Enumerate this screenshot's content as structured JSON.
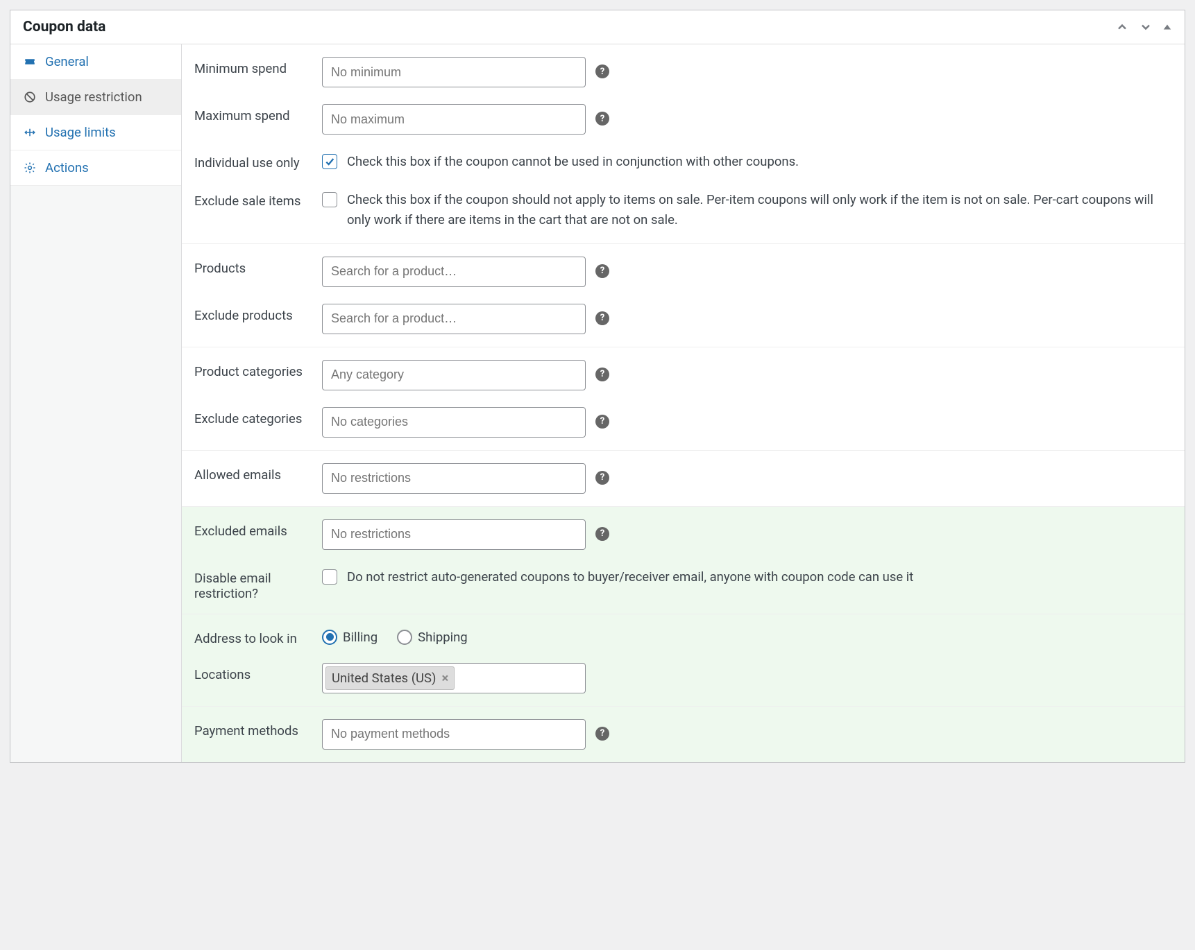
{
  "panel": {
    "title": "Coupon data"
  },
  "tabs": {
    "general": "General",
    "usage_restriction": "Usage restriction",
    "usage_limits": "Usage limits",
    "actions": "Actions"
  },
  "labels": {
    "minimum_spend": "Minimum spend",
    "maximum_spend": "Maximum spend",
    "individual_use": "Individual use only",
    "exclude_sale": "Exclude sale items",
    "products": "Products",
    "exclude_products": "Exclude products",
    "product_categories": "Product categories",
    "exclude_categories": "Exclude categories",
    "allowed_emails": "Allowed emails",
    "excluded_emails": "Excluded emails",
    "disable_email_restriction": "Disable email restriction?",
    "address_to_look_in": "Address to look in",
    "locations": "Locations",
    "payment_methods": "Payment methods"
  },
  "placeholders": {
    "minimum_spend": "No minimum",
    "maximum_spend": "No maximum",
    "search_product": "Search for a product…",
    "any_category": "Any category",
    "no_categories": "No categories",
    "no_restrictions": "No restrictions",
    "no_payment_methods": "No payment methods"
  },
  "descriptions": {
    "individual_use": "Check this box if the coupon cannot be used in conjunction with other coupons.",
    "exclude_sale": "Check this box if the coupon should not apply to items on sale. Per-item coupons will only work if the item is not on sale. Per-cart coupons will only work if there are items in the cart that are not on sale.",
    "disable_email_restriction": "Do not restrict auto-generated coupons to buyer/receiver email, anyone with coupon code can use it"
  },
  "radios": {
    "billing": "Billing",
    "shipping": "Shipping"
  },
  "locations": {
    "selected": "United States (US)"
  }
}
